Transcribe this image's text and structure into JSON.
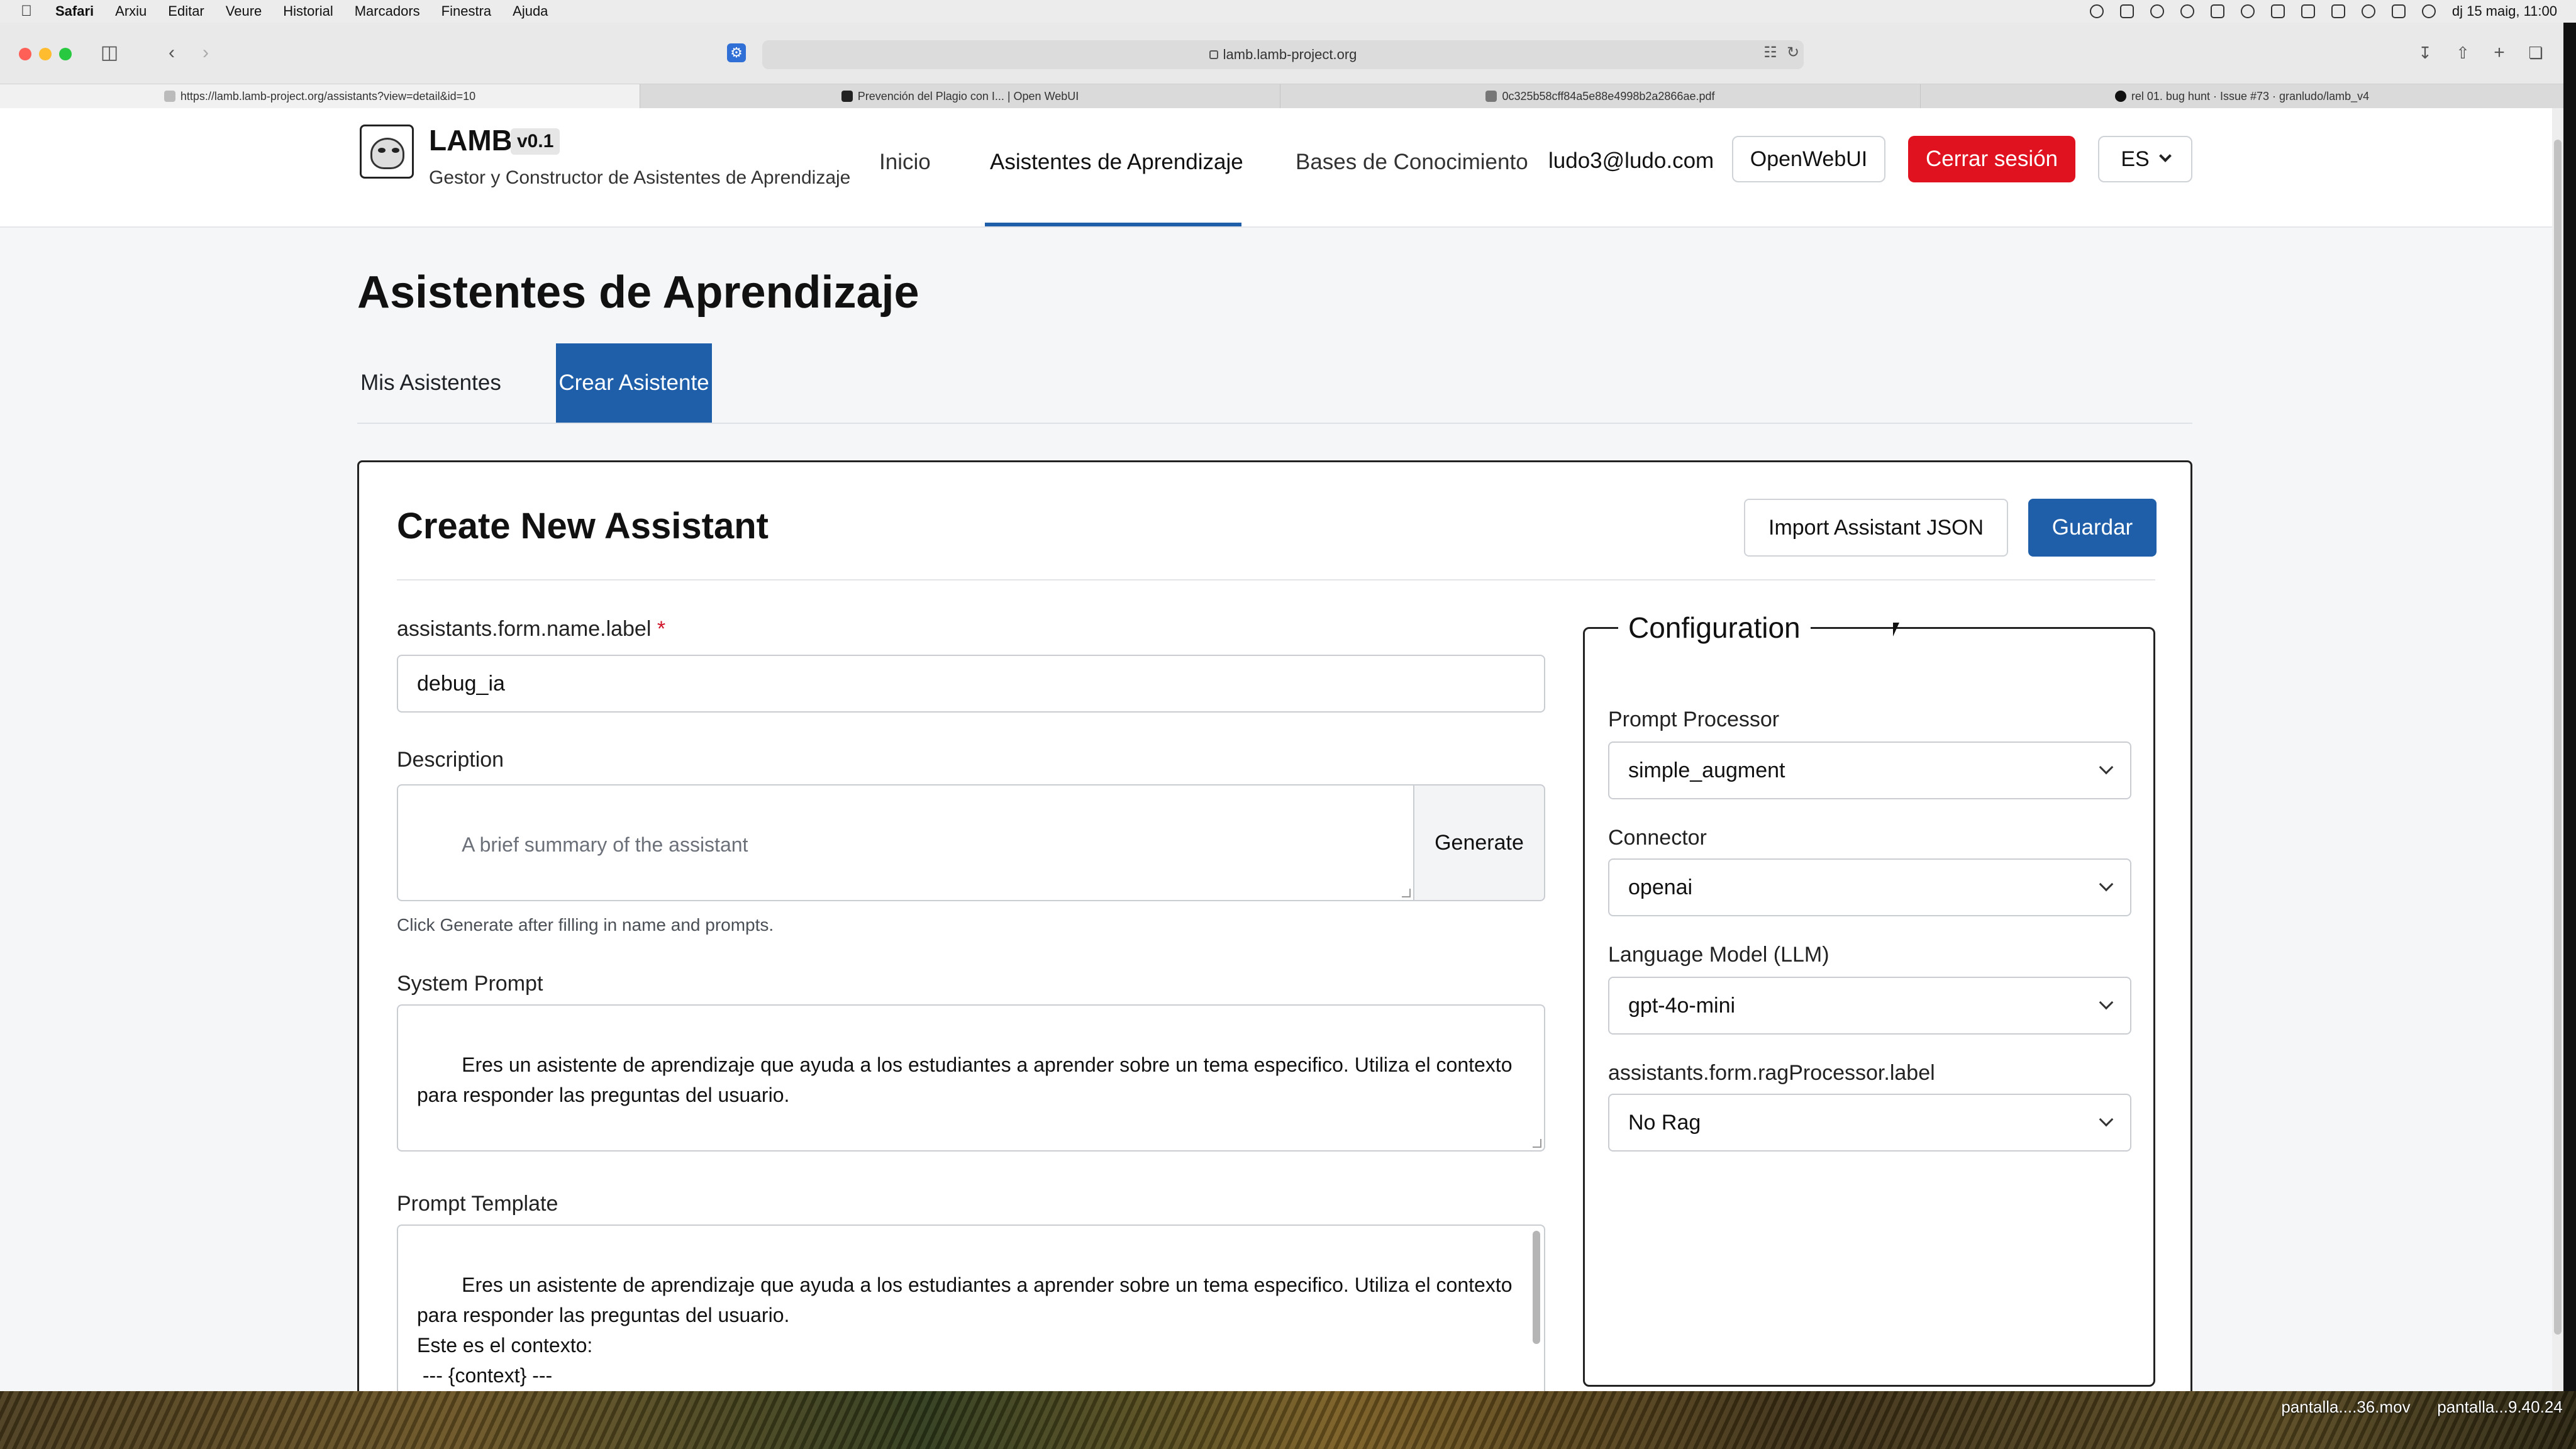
{
  "menubar": {
    "items": [
      "Safari",
      "Arxiu",
      "Editar",
      "Veure",
      "Historial",
      "Marcadors",
      "Finestra",
      "Ajuda"
    ],
    "datetime": "dj 15 maig, 11:00"
  },
  "browser": {
    "url": "lamb.lamb-project.org",
    "tabs": [
      {
        "title": "https://lamb.lamb-project.org/assistants?view=detail&id=10"
      },
      {
        "title": "Prevención del Plagio con I... | Open WebUI"
      },
      {
        "title": "0c325b58cff84a5e88e4998b2a2866ae.pdf"
      },
      {
        "title": "rel 01. bug hunt · Issue #73 · granludo/lamb_v4"
      }
    ]
  },
  "app": {
    "name": "LAMB",
    "version": "v0.1",
    "subtitle": "Gestor y Constructor de Asistentes de Aprendizaje",
    "nav": [
      "Inicio",
      "Asistentes de Aprendizaje",
      "Bases de Conocimiento"
    ],
    "user_email": "ludo3@ludo.com",
    "openwebui_label": "OpenWebUI",
    "logout_label": "Cerrar sesión",
    "language": "ES"
  },
  "page": {
    "title": "Asistentes de Aprendizaje",
    "tabs": [
      "Mis Asistentes",
      "Crear Asistente"
    ]
  },
  "form": {
    "title": "Create New Assistant",
    "import_label": "Import Assistant JSON",
    "save_label": "Guardar",
    "name_label": "assistants.form.name.label",
    "name_required": "*",
    "name_value": "debug_ia",
    "description_label": "Description",
    "description_placeholder": "A brief summary of the assistant",
    "generate_label": "Generate",
    "description_hint": "Click Generate after filling in name and prompts.",
    "system_prompt_label": "System Prompt",
    "system_prompt_value": "Eres un asistente de aprendizaje que ayuda a los estudiantes a aprender sobre un tema especifico. Utiliza el contexto\npara responder las preguntas del usuario.",
    "prompt_template_label": "Prompt Template",
    "prompt_template_value": "Eres un asistente de aprendizaje que ayuda a los estudiantes a aprender sobre un tema especifico. Utiliza el contexto\npara responder las preguntas del usuario.\nEste es el contexto:\n --- {context} ---\n\nAhora responde la pregunta del usuario: {user_input}"
  },
  "config": {
    "title": "Configuration",
    "prompt_processor_label": "Prompt Processor",
    "prompt_processor_value": "simple_augment",
    "connector_label": "Connector",
    "connector_value": "openai",
    "llm_label": "Language Model (LLM)",
    "llm_value": "gpt-4o-mini",
    "rag_label": "assistants.form.ragProcessor.label",
    "rag_value": "No Rag"
  },
  "desktop": {
    "files": [
      "pantalla....36.mov",
      "pantalla...9.40.24"
    ]
  },
  "colors": {
    "primary": "#1f5fa9",
    "danger": "#e0121f"
  }
}
